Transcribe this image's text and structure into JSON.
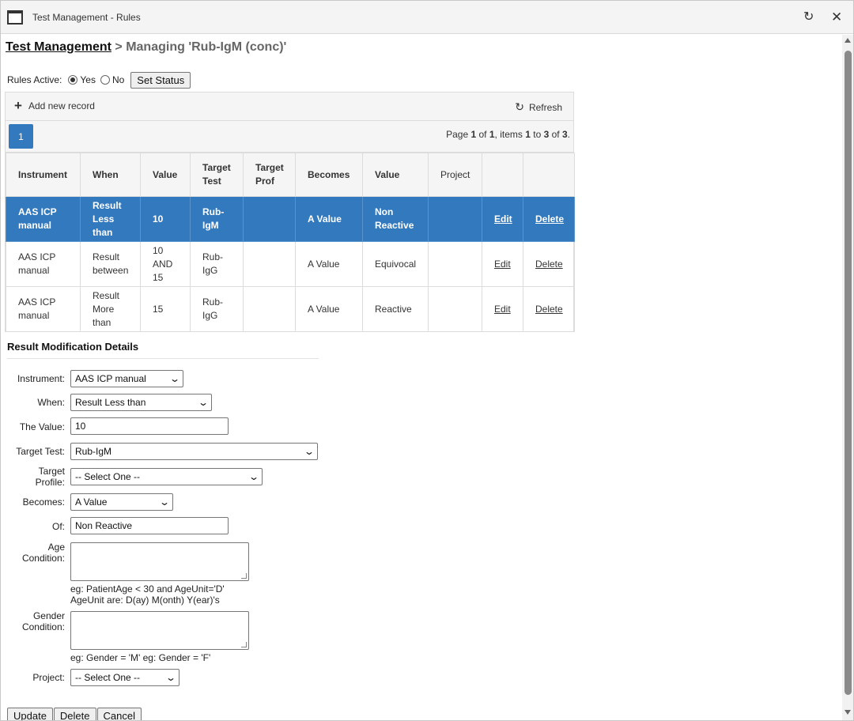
{
  "window": {
    "title": "Test Management - Rules"
  },
  "breadcrumb": {
    "root": "Test Management",
    "separator": ">",
    "current": "Managing 'Rub-IgM (conc)'"
  },
  "rules_active": {
    "label": "Rules Active:",
    "yes": "Yes",
    "no": "No",
    "selected": "Yes",
    "set_status": "Set Status"
  },
  "grid": {
    "add_new": "Add new record",
    "refresh": "Refresh",
    "current_page": "1",
    "page_info": {
      "p1": "Page ",
      "n1": "1",
      "p2": " of ",
      "n2": "1",
      "p3": ", items ",
      "n3": "1",
      "p4": " to ",
      "n4": "3",
      "p5": " of ",
      "n5": "3",
      "p6": "."
    },
    "columns": [
      "Instrument",
      "When",
      "Value",
      "Target Test",
      "Target Prof",
      "Becomes",
      "Value",
      "Project",
      "",
      ""
    ],
    "rows": [
      {
        "instrument": "AAS ICP manual",
        "when": "Result Less than",
        "value": "10",
        "target_test": "Rub-IgM",
        "target_prof": "",
        "becomes": "A Value",
        "result_value": "Non Reactive",
        "project": "",
        "edit": "Edit",
        "delete": "Delete",
        "selected": true
      },
      {
        "instrument": "AAS ICP manual",
        "when": "Result between",
        "value": "10 AND 15",
        "target_test": "Rub-IgG",
        "target_prof": "",
        "becomes": "A Value",
        "result_value": "Equivocal",
        "project": "",
        "edit": "Edit",
        "delete": "Delete",
        "selected": false
      },
      {
        "instrument": "AAS ICP manual",
        "when": "Result More than",
        "value": "15",
        "target_test": "Rub-IgG",
        "target_prof": "",
        "becomes": "A Value",
        "result_value": "Reactive",
        "project": "",
        "edit": "Edit",
        "delete": "Delete",
        "selected": false
      }
    ]
  },
  "details": {
    "title": "Result Modification Details",
    "instrument": {
      "label": "Instrument:",
      "value": "AAS ICP manual"
    },
    "when": {
      "label": "When:",
      "value": "Result Less than"
    },
    "the_value": {
      "label": "The Value:",
      "value": "10"
    },
    "target_test": {
      "label": "Target Test:",
      "value": "Rub-IgM"
    },
    "target_profile": {
      "label_line1": "Target",
      "label_line2": "Profile:",
      "value": "-- Select One --"
    },
    "becomes": {
      "label": "Becomes:",
      "value": "A Value"
    },
    "of": {
      "label": "Of:",
      "value": "Non Reactive"
    },
    "age_condition": {
      "label_line1": "Age",
      "label_line2": "Condition:",
      "value": "",
      "hint_line1": "eg: PatientAge < 30 and AgeUnit='D'",
      "hint_line2": "AgeUnit are: D(ay) M(onth) Y(ear)'s"
    },
    "gender_condition": {
      "label_line1": "Gender",
      "label_line2": "Condition:",
      "value": "",
      "hint": "eg: Gender = 'M' eg: Gender = 'F'"
    },
    "project": {
      "label": "Project:",
      "value": "-- Select One --"
    }
  },
  "buttons": {
    "update": "Update",
    "delete": "Delete",
    "cancel": "Cancel"
  },
  "colors": {
    "selected_row": "#3279be",
    "page_button": "#3279be"
  },
  "icons": {
    "window": "window-icon",
    "refresh": "refresh-icon",
    "close": "close-icon",
    "add": "plus-icon"
  }
}
